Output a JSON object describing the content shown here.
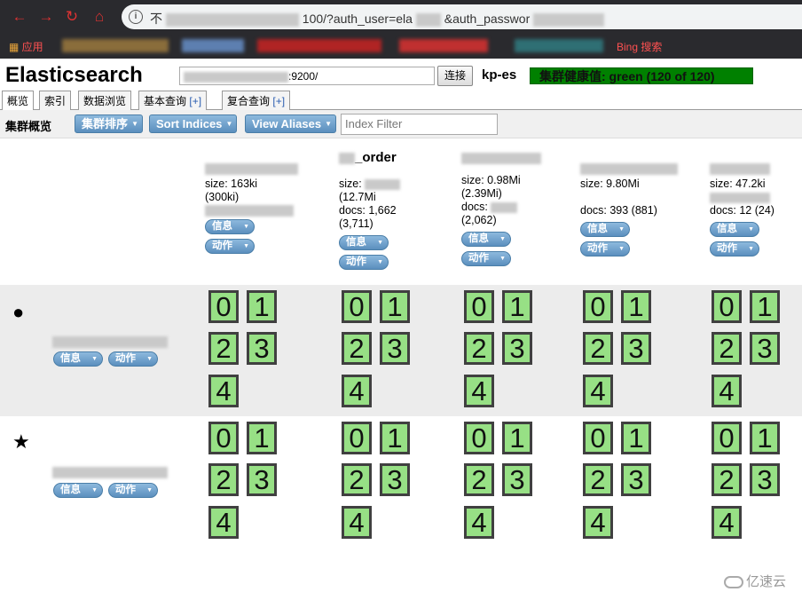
{
  "browser": {
    "url_visible_parts": [
      "不",
      "100/?auth_user=ela",
      "&auth_passwor"
    ],
    "bookmarks": {
      "apps_label": "应用",
      "bing_label": "Bing 搜索"
    }
  },
  "app": {
    "title": "Elasticsearch",
    "connection_url_suffix": ":9200/",
    "connect_label": "连接",
    "cluster_name": "kp-es",
    "health": "集群健康值: green (120 of 120)",
    "health_color": "#008000"
  },
  "tabs": [
    {
      "label": "概览",
      "active": true
    },
    {
      "label": "索引"
    },
    {
      "label": "数据浏览"
    },
    {
      "label": "基本查询",
      "plus": "[+]"
    },
    {
      "label": "复合查询",
      "plus": "[+]"
    }
  ],
  "toolbar": {
    "label": "集群概览",
    "sort_cluster": "集群排序",
    "sort_indices": "Sort Indices",
    "view_aliases": "View Aliases",
    "index_filter_placeholder": "Index Filter"
  },
  "indices": [
    {
      "name": "",
      "size": "size: 163ki",
      "size_total": "(300ki)",
      "docs": "",
      "docs_total": "",
      "info": "信息",
      "action": "动作"
    },
    {
      "name": "_order",
      "size": "size:",
      "size_total": "(12.7Mi",
      "docs": "docs: 1,662",
      "docs_total": "(3,711)",
      "info": "信息",
      "action": "动作"
    },
    {
      "name": "",
      "size": "size: 0.98Mi",
      "size_total": "(2.39Mi)",
      "docs": "docs:",
      "docs_total": "(2,062)",
      "info": "信息",
      "action": "动作"
    },
    {
      "name": "",
      "size": "size: 9.80Mi",
      "size_total": "",
      "docs": "docs: 393 (881)",
      "docs_total": "",
      "info": "信息",
      "action": "动作"
    },
    {
      "name": "",
      "size": "size: 47.2ki",
      "size_total": "",
      "docs": "docs: 12 (24)",
      "docs_total": "",
      "info": "信息",
      "action": "动作"
    }
  ],
  "nodes": [
    {
      "symbol": "●",
      "info": "信息",
      "action": "动作"
    },
    {
      "symbol": "★",
      "info": "信息",
      "action": "动作"
    }
  ],
  "shards": [
    "0",
    "1",
    "2",
    "3",
    "4"
  ],
  "watermark": "亿速云"
}
